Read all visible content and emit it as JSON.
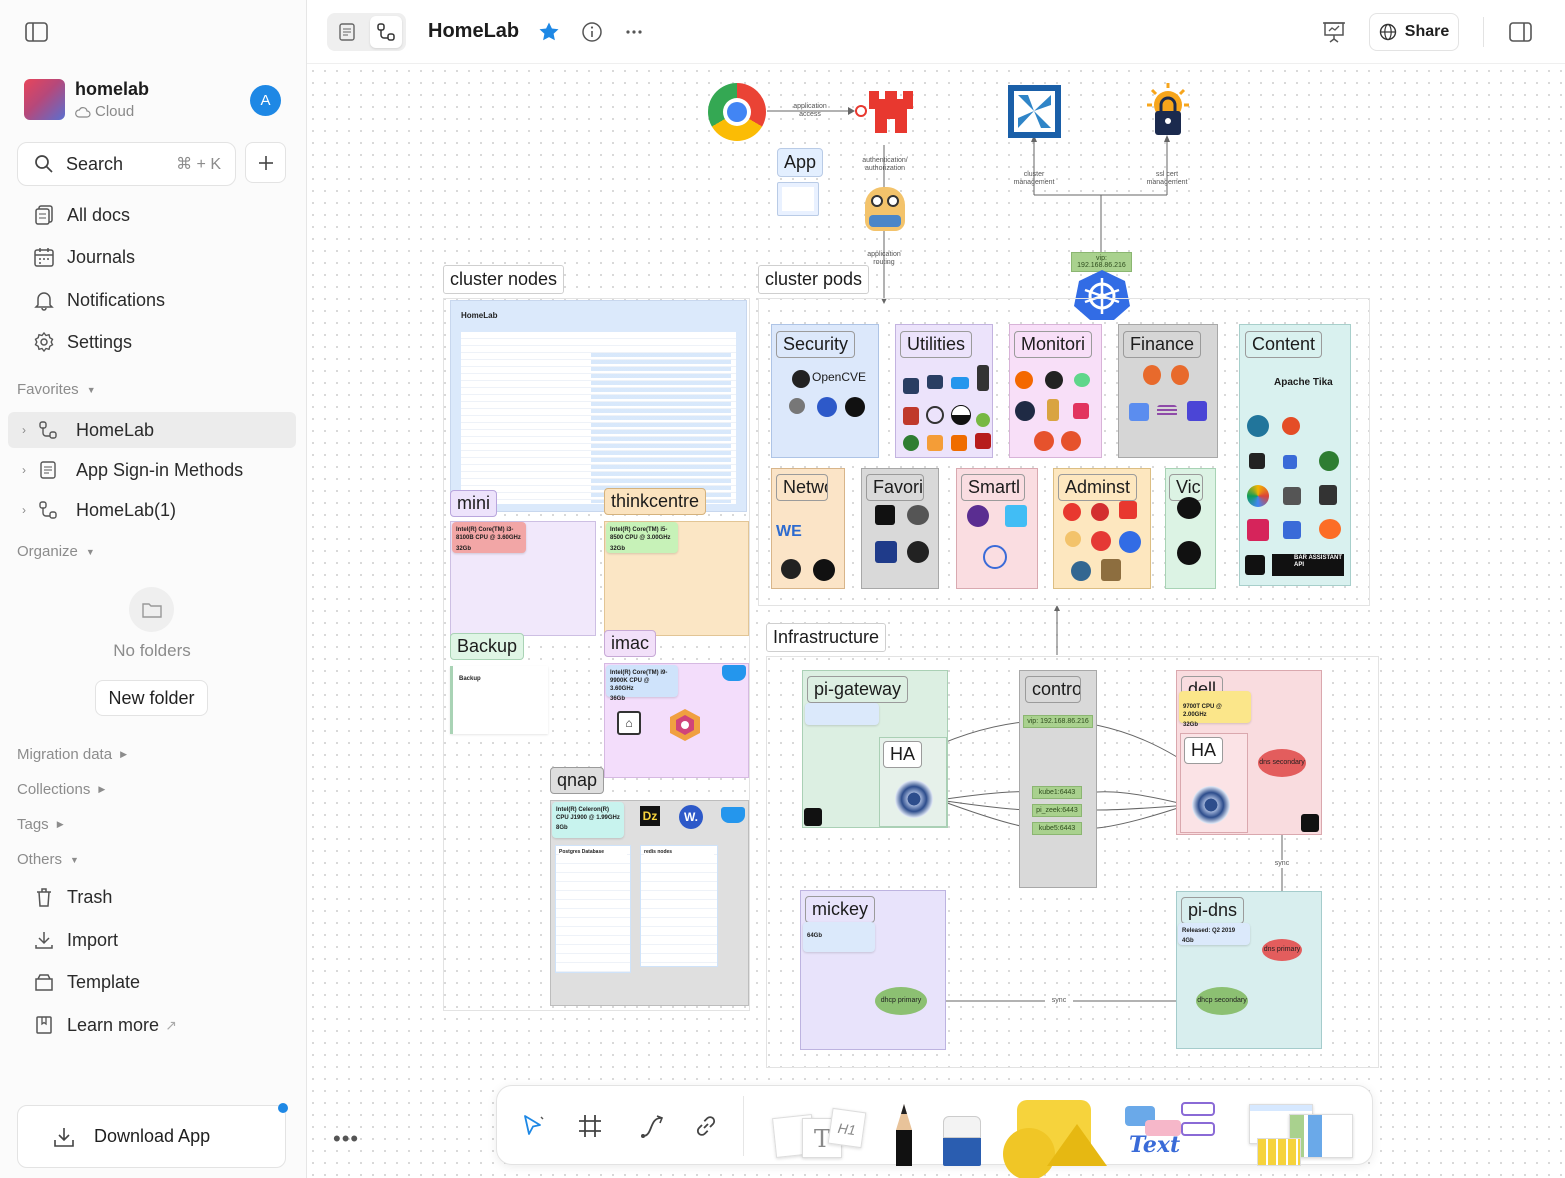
{
  "workspace": {
    "name": "homelab",
    "storage": "Cloud",
    "user_initial": "A"
  },
  "sidebar": {
    "search_label": "Search",
    "search_shortcut": "⌘ + K",
    "nav": [
      {
        "label": "All docs",
        "icon": "all-docs-icon"
      },
      {
        "label": "Journals",
        "icon": "calendar-icon"
      },
      {
        "label": "Notifications",
        "icon": "bell-icon"
      },
      {
        "label": "Settings",
        "icon": "gear-icon"
      }
    ],
    "favorites_label": "Favorites",
    "favorites": [
      {
        "label": "HomeLab",
        "icon": "edgeless-icon",
        "active": true
      },
      {
        "label": "App Sign-in Methods",
        "icon": "page-icon",
        "active": false
      },
      {
        "label": "HomeLab(1)",
        "icon": "edgeless-icon",
        "active": false
      }
    ],
    "organize_label": "Organize",
    "no_folders": "No folders",
    "new_folder": "New folder",
    "sections": [
      "Migration data",
      "Collections",
      "Tags",
      "Others"
    ],
    "others": [
      {
        "label": "Trash",
        "icon": "trash-icon"
      },
      {
        "label": "Import",
        "icon": "import-icon"
      },
      {
        "label": "Template",
        "icon": "template-icon"
      },
      {
        "label": "Learn more",
        "icon": "book-icon",
        "suffix": "↗"
      }
    ],
    "download_app": "Download App"
  },
  "header": {
    "title": "HomeLab",
    "share": "Share"
  },
  "canvas": {
    "frames": {
      "cluster_nodes": "cluster nodes",
      "cluster_pods": "cluster pods",
      "infrastructure": "Infrastructure"
    },
    "app_card_label": "App",
    "homelab_table_title": "HomeLab",
    "edge_labels": {
      "application_access": "application access",
      "auth": "authentication/ authorization",
      "routing": "application routing",
      "cluster_mgmt": "cluster management",
      "ssl_mgmt": "ssl cert management",
      "vip_top": "vip: 192.168.86.216",
      "sync_h": "sync",
      "sync_v": "sync"
    },
    "node_groups": {
      "mini": {
        "label": "mini",
        "spec": "Intel(R) Core(TM) i3-8100B CPU @ 3.60GHz",
        "mem": "32Gb"
      },
      "thinkcentre": {
        "label": "thinkcentre",
        "spec": "Intel(R) Core(TM) i5-8500 CPU @ 3.00GHz",
        "mem": "32Gb"
      },
      "backup": {
        "label": "Backup",
        "doc_title": "Backup"
      },
      "imac": {
        "label": "imac",
        "spec": "Intel(R) Core(TM) i9-9900K CPU @ 3.60GHz",
        "mem": "36Gb"
      },
      "qnap": {
        "label": "qnap",
        "spec": "Intel(R) Celeron(R) CPU J1900 @ 1.99GHz",
        "mem": "8Gb",
        "db1": "Postgres Database",
        "db2": "redis nodes"
      }
    },
    "pod_groups": [
      {
        "label": "Security",
        "text": "OpenCVE"
      },
      {
        "label": "Utilities"
      },
      {
        "label": "Monitori"
      },
      {
        "label": "Finance"
      },
      {
        "label": "Content",
        "text": "Apache Tika",
        "text2": "BAR ASSISTANT API"
      },
      {
        "label": "Netwo"
      },
      {
        "label": "Favori"
      },
      {
        "label": "Smartl"
      },
      {
        "label": "Adminst"
      },
      {
        "label": "Vic"
      }
    ],
    "infra": {
      "pi_gateway": {
        "label": "pi-gateway",
        "ha": "HA"
      },
      "control": {
        "label": "contro",
        "vip": "vip: 192.168.86.216",
        "chips": [
          "kube1:6443",
          "pi_zeek:6443",
          "kube5:6443"
        ]
      },
      "dell": {
        "label": "dell",
        "spec": "9700T CPU @ 2.00GHz",
        "mem": "32Gb",
        "ha": "HA"
      },
      "mickey": {
        "label": "mickey",
        "mem": "64Gb"
      },
      "pi_dns": {
        "label": "pi-dns",
        "released": "Released: Q2 2019",
        "mem": "4Gb"
      },
      "dns_secondary": "dns secondary",
      "dns_primary": "dns primary",
      "dhcp_primary": "dhcp primary",
      "dhcp_secondary": "dhcp secondary"
    }
  },
  "toolbar": {
    "tools": [
      "select",
      "frame",
      "connector",
      "link",
      "text-note",
      "pen",
      "eraser",
      "shapes",
      "mindmap",
      "templates"
    ]
  },
  "colors": {
    "accent": "#1e88e5",
    "star": "#1e88e5",
    "k8s": "#326ce5"
  }
}
